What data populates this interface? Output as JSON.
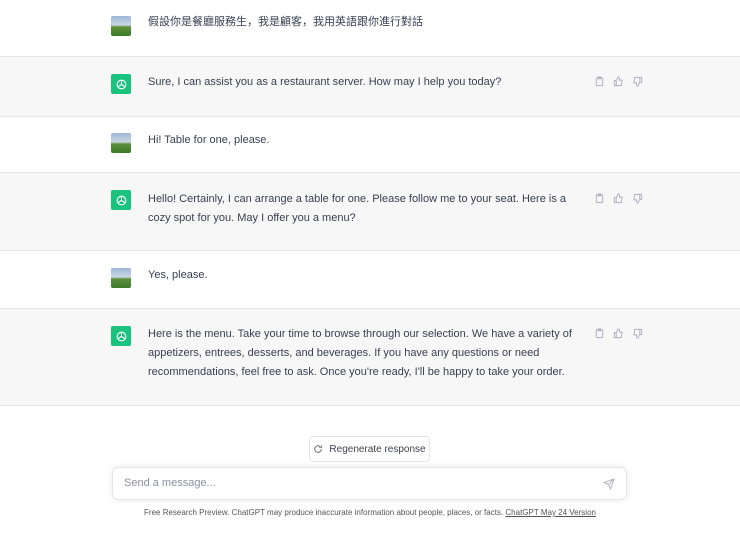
{
  "messages": [
    {
      "role": "user",
      "text": "假設你是餐廳服務生，我是顧客，我用英語跟你進行對話"
    },
    {
      "role": "assistant",
      "text": "Sure, I can assist you as a restaurant server. How may I help you today?"
    },
    {
      "role": "user",
      "text": "Hi! Table for one, please."
    },
    {
      "role": "assistant",
      "text": "Hello! Certainly, I can arrange a table for one. Please follow me to your seat. Here is a cozy spot for you. May I offer you a menu?"
    },
    {
      "role": "user",
      "text": "Yes, please."
    },
    {
      "role": "assistant",
      "text": "Here is the menu. Take your time to browse through our selection. We have a variety of appetizers, entrees, desserts, and beverages. If you have any questions or need recommendations, feel free to ask. Once you're ready, I'll be happy to take your order."
    }
  ],
  "regenerate_label": "Regenerate response",
  "input": {
    "placeholder": "Send a message...",
    "value": ""
  },
  "footer": {
    "text": "Free Research Preview. ChatGPT may produce inaccurate information about people, places, or facts. ",
    "link": "ChatGPT May 24 Version"
  },
  "colors": {
    "accent": "#19c37d",
    "bot_bg": "#f7f7f8"
  }
}
